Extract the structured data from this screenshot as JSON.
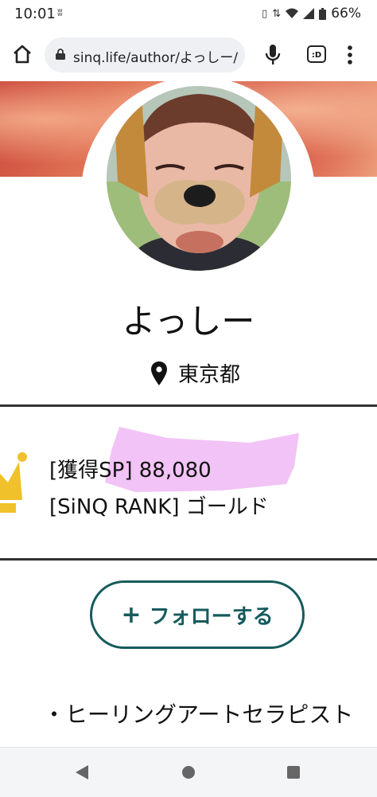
{
  "status_bar": {
    "time": "10:01",
    "battery": "66%"
  },
  "browser": {
    "url": "sinq.life/author/よっしー/"
  },
  "profile": {
    "name": "よっしー",
    "location": "東京都",
    "sp_line": "[獲得SP] 88,080",
    "rank_line": "[SiNQ RANK] ゴールド",
    "follow_label": "フォローする",
    "bio_line": "・ヒーリングアートセラピスト"
  },
  "colors": {
    "accent": "#165b5d",
    "highlight": "#f0b8f4"
  }
}
